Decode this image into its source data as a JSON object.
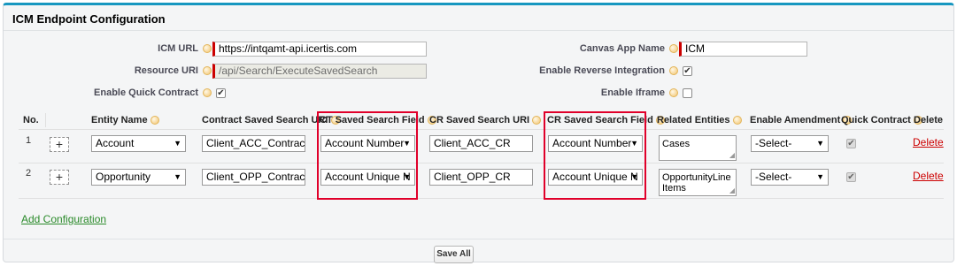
{
  "panel": {
    "title": "ICM Endpoint Configuration"
  },
  "fields": {
    "icm_url_label": "ICM URL",
    "icm_url_value": "https://intqamt-api.icertis.com",
    "resource_uri_label": "Resource URI",
    "resource_uri_value": "/api/Search/ExecuteSavedSearch",
    "enable_quick_contract_label": "Enable Quick Contract",
    "canvas_app_name_label": "Canvas App Name",
    "canvas_app_name_value": "ICM",
    "enable_reverse_integration_label": "Enable Reverse Integration",
    "enable_iframe_label": "Enable Iframe"
  },
  "checkbox_states": {
    "enable_quick_contract": true,
    "enable_reverse_integration": true,
    "enable_iframe": false
  },
  "grid": {
    "headers": {
      "no": "No.",
      "entity_name": "Entity Name",
      "contract_saved_search_uri": "Contract Saved Search URI",
      "ct_saved_search_field": "CT Saved Search Field",
      "cr_saved_search_uri": "CR Saved Search URI",
      "cr_saved_search_field": "CR Saved Search Field",
      "related_entities": "Related Entities",
      "enable_amendment": "Enable Amendment",
      "quick_contract": "Quick Contract",
      "delete": "Delete"
    },
    "rows": [
      {
        "no": "1",
        "plus": "+",
        "entity_name": "Account",
        "contract_uri": "Client_ACC_Contract",
        "ct_field": "Account Number",
        "cr_uri": "Client_ACC_CR",
        "cr_field": "Account Number",
        "related_entities": "Cases",
        "enable_amendment": "-Select-",
        "quick_contract": true,
        "delete": "Delete"
      },
      {
        "no": "2",
        "plus": "+",
        "entity_name": "Opportunity",
        "contract_uri": "Client_OPP_Contract",
        "ct_field": "Account Unique N",
        "cr_uri": "Client_OPP_CR",
        "cr_field": "Account Unique N",
        "related_entities": "OpportunityLineItems",
        "enable_amendment": "-Select-",
        "quick_contract": true,
        "delete": "Delete"
      }
    ]
  },
  "actions": {
    "add_configuration": "Add Configuration",
    "save_all": "Save All"
  },
  "icons": {
    "help": "help-icon",
    "dropdown": "dropdown-arrow-icon",
    "check": "checkmark-icon"
  },
  "colors": {
    "accent_top_border": "#1797c0",
    "required_marker": "#cc0000",
    "highlight_box": "#e0002a",
    "delete_link": "#cc0000",
    "add_link": "#2a8a2a"
  }
}
